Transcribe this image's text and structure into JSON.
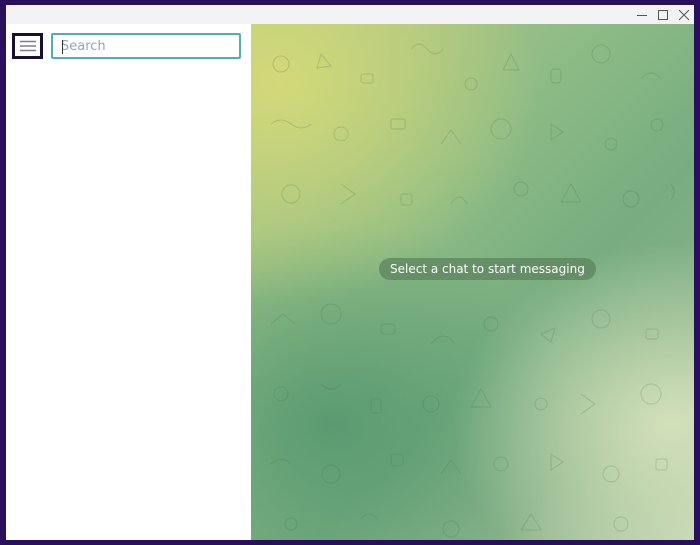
{
  "window": {
    "controls": {
      "minimize_icon": "minimize-icon",
      "maximize_icon": "maximize-icon",
      "close_icon": "close-icon"
    }
  },
  "sidebar": {
    "menu_icon": "hamburger-menu-icon",
    "search": {
      "placeholder": "Search",
      "value": ""
    }
  },
  "chat": {
    "empty_hint": "Select a chat to start messaging",
    "background_colors": [
      "#d4da78",
      "#8fbc86",
      "#77ad80",
      "#c2d6b3"
    ]
  },
  "colors": {
    "search_border": "#52aeb0",
    "menu_border": "#1c1030",
    "outer_frame": "#2a0f5c"
  }
}
